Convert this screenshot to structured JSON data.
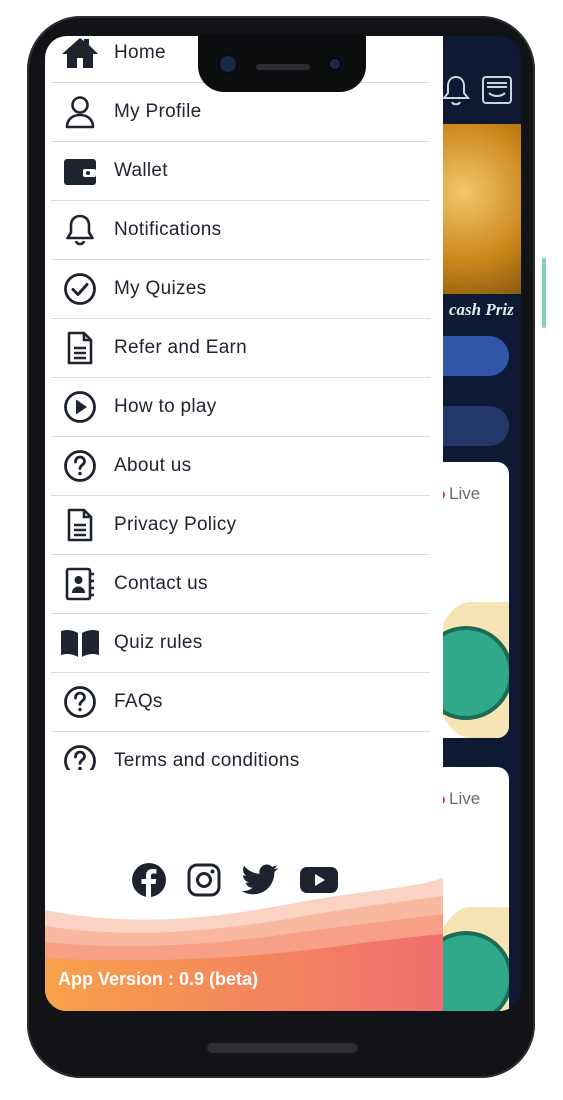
{
  "menu": {
    "items": [
      {
        "label": "Home",
        "icon": "home-icon"
      },
      {
        "label": "My Profile",
        "icon": "user-icon"
      },
      {
        "label": "Wallet",
        "icon": "wallet-icon"
      },
      {
        "label": "Notifications",
        "icon": "bell-icon"
      },
      {
        "label": "My Quizes",
        "icon": "check-circle-icon"
      },
      {
        "label": "Refer and Earn",
        "icon": "document-icon"
      },
      {
        "label": "How to play",
        "icon": "play-circle-icon"
      },
      {
        "label": "About us",
        "icon": "question-circle-icon"
      },
      {
        "label": "Privacy Policy",
        "icon": "document-icon"
      },
      {
        "label": "Contact us",
        "icon": "contact-book-icon"
      },
      {
        "label": "Quiz rules",
        "icon": "book-open-icon"
      },
      {
        "label": "FAQs",
        "icon": "question-circle-icon"
      },
      {
        "label": "Terms and conditions",
        "icon": "question-circle-icon"
      }
    ]
  },
  "social": [
    "facebook-icon",
    "instagram-icon",
    "twitter-icon",
    "youtube-icon"
  ],
  "footer": {
    "version": "App Version : 0.9 (beta)"
  },
  "background": {
    "banner_text": "cash Priz",
    "live_label": "Live"
  },
  "colors": {
    "drawer_bg": "#ffffff",
    "icon": "#1f2330",
    "app_bg": "#0e1a33",
    "footer_gradient_start": "#f7a14a",
    "footer_gradient_end": "#f06e6e"
  }
}
